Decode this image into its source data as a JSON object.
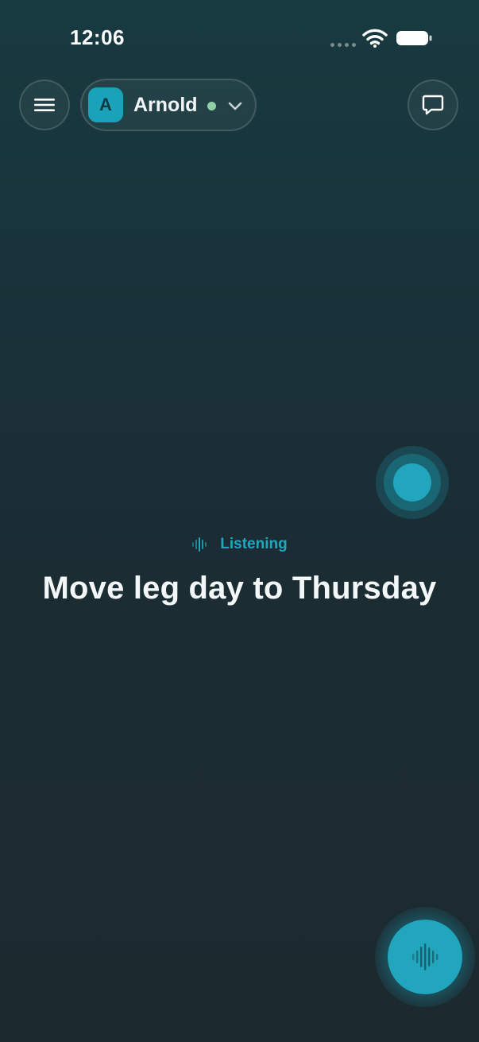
{
  "status_bar": {
    "time": "12:06"
  },
  "header": {
    "agent": {
      "initial": "A",
      "name": "Arnold",
      "status_color": "#8fd0a6"
    }
  },
  "voice": {
    "state_label": "Listening",
    "transcript": "Move leg day to Thursday"
  },
  "colors": {
    "accent": "#21a6bd",
    "background": "#1b2c33"
  },
  "icons": {
    "menu": "hamburger-icon",
    "chat": "chat-bubble-icon",
    "dropdown": "chevron-down-icon",
    "waveform": "waveform-icon"
  }
}
